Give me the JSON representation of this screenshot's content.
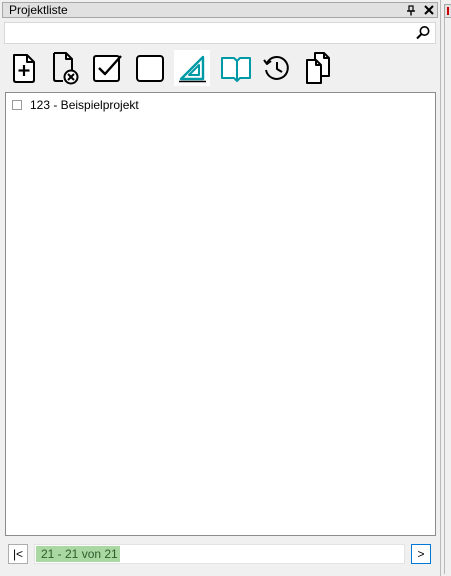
{
  "panel": {
    "title": "Projektliste",
    "pin_glyph": "―",
    "close_glyph": "✕"
  },
  "search": {
    "value": "",
    "placeholder": "",
    "icon": "search-icon"
  },
  "toolbar": {
    "buttons": [
      {
        "name": "new-project-button",
        "icon": "new-document-icon"
      },
      {
        "name": "delete-project-button",
        "icon": "delete-document-icon"
      },
      {
        "name": "select-all-button",
        "icon": "checked-box-icon"
      },
      {
        "name": "deselect-all-button",
        "icon": "empty-box-icon"
      },
      {
        "name": "measure-button",
        "icon": "triangle-ruler-icon",
        "active": true
      },
      {
        "name": "notebook-button",
        "icon": "notebook-icon"
      },
      {
        "name": "history-button",
        "icon": "history-icon"
      },
      {
        "name": "copy-button",
        "icon": "copy-documents-icon"
      }
    ],
    "accent_color": "#009aa6"
  },
  "list": {
    "items": [
      {
        "label": "123 - Beispielprojekt",
        "checked": false
      }
    ]
  },
  "pager": {
    "first_label": "|<",
    "next_label": ">",
    "status": "21 - 21 von 21",
    "status_color": "#a9d8a3"
  }
}
